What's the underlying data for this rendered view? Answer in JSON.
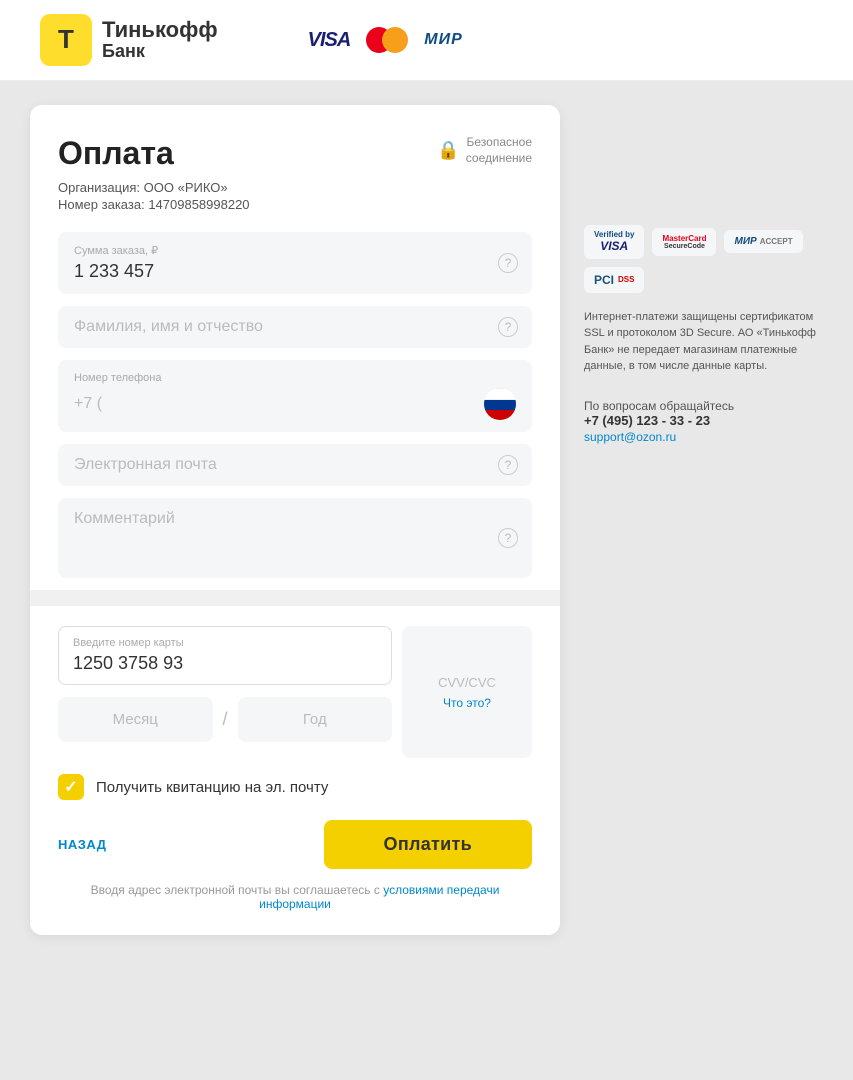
{
  "header": {
    "bank_name_line1": "Тинькофф",
    "bank_name_line2": "Банк",
    "card_logos": {
      "visa": "VISA",
      "mir": "МИР"
    }
  },
  "payment_form": {
    "title": "Оплата",
    "secure_label": "Безопасное\nсоединение",
    "org_label": "Организация:",
    "org_value": "ООО «РИКО»",
    "order_label": "Номер заказа:",
    "order_value": "14709858998220",
    "amount_field": {
      "label": "Сумма заказа, ₽",
      "value": "1 233 457"
    },
    "name_field": {
      "placeholder": "Фамилия, имя и отчество"
    },
    "phone_field": {
      "label": "Номер телефона",
      "value": "+7 ("
    },
    "email_field": {
      "placeholder": "Электронная почта"
    },
    "comment_field": {
      "placeholder": "Комментарий"
    },
    "card_number_field": {
      "label": "Введите номер карты",
      "value": "1250  3758  93"
    },
    "month_placeholder": "Месяц",
    "year_placeholder": "Год",
    "cvv_label": "CVV/CVC",
    "cvv_what": "Что это?",
    "receipt_checkbox": {
      "label": "Получить квитанцию на эл. почту",
      "checked": true
    },
    "back_button": "НАЗАД",
    "pay_button": "Оплатить",
    "terms_text": "Вводя адрес электронной почты вы соглашаетесь с",
    "terms_link_text": "условиями передачи информации"
  },
  "right_panel": {
    "info_text": "Интернет-платежи защищены сертификатом SSL и протоколом 3D Secure. АО «Тинькофф Банк» не передает магазинам платежные данные, в том числе данные карты.",
    "support_label": "По вопросам обращайтесь",
    "support_phone": "+7 (495) 123 - 33 - 23",
    "support_email": "support@ozon.ru",
    "badges": {
      "verified_by_visa": "Verified by VISA",
      "mastercard_securecode": "MasterCard SecureCode",
      "mir_accept": "MIR ACCEPT",
      "pci_dss": "PCI DSS"
    }
  }
}
